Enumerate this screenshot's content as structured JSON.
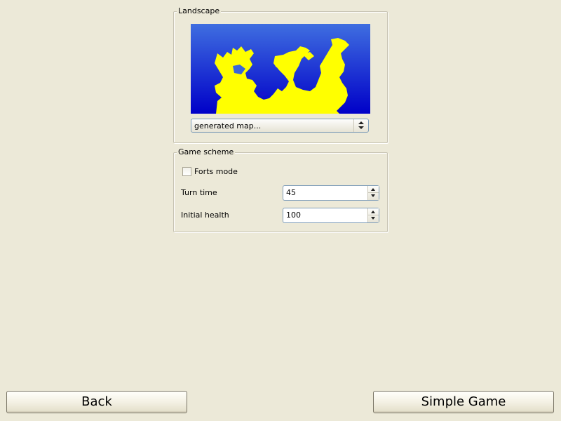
{
  "landscape": {
    "title": "Landscape",
    "map_selector": {
      "value": "generated map..."
    },
    "preview": {
      "sky_top": "#3f6ee0",
      "sky_bottom": "#0000c8",
      "land": "#ffff00"
    }
  },
  "game_scheme": {
    "title": "Game scheme",
    "forts_mode": {
      "label": "Forts mode",
      "checked": false
    },
    "turn_time": {
      "label": "Turn time",
      "value": "45"
    },
    "initial_health": {
      "label": "Initial health",
      "value": "100"
    }
  },
  "buttons": {
    "back": "Back",
    "simple_game": "Simple Game"
  }
}
